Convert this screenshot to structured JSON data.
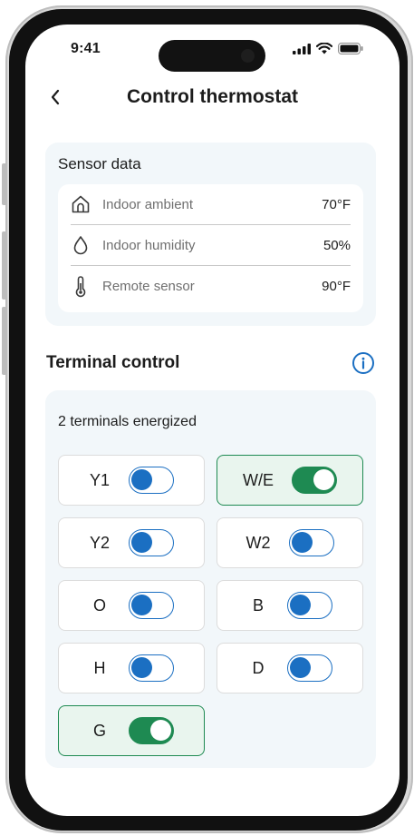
{
  "status_bar": {
    "time": "9:41"
  },
  "header": {
    "title": "Control thermostat"
  },
  "sensor_card": {
    "title": "Sensor data",
    "rows": [
      {
        "icon": "home-icon",
        "label": "Indoor ambient",
        "value": "70°F"
      },
      {
        "icon": "droplet-icon",
        "label": "Indoor humidity",
        "value": "50%"
      },
      {
        "icon": "thermometer-icon",
        "label": "Remote sensor",
        "value": "90°F"
      }
    ]
  },
  "terminal_section": {
    "heading": "Terminal control",
    "energized_text": "2 terminals energized",
    "terminals": [
      {
        "label": "Y1",
        "on": false
      },
      {
        "label": "W/E",
        "on": true
      },
      {
        "label": "Y2",
        "on": false
      },
      {
        "label": "W2",
        "on": false
      },
      {
        "label": "O",
        "on": false
      },
      {
        "label": "B",
        "on": false
      },
      {
        "label": "H",
        "on": false
      },
      {
        "label": "D",
        "on": false
      },
      {
        "label": "G",
        "on": true
      }
    ]
  },
  "colors": {
    "toggle_off": "#1b6fc2",
    "toggle_on": "#1e8a52",
    "card_bg": "#f2f7fa",
    "active_btn_bg": "#e9f5ee"
  }
}
